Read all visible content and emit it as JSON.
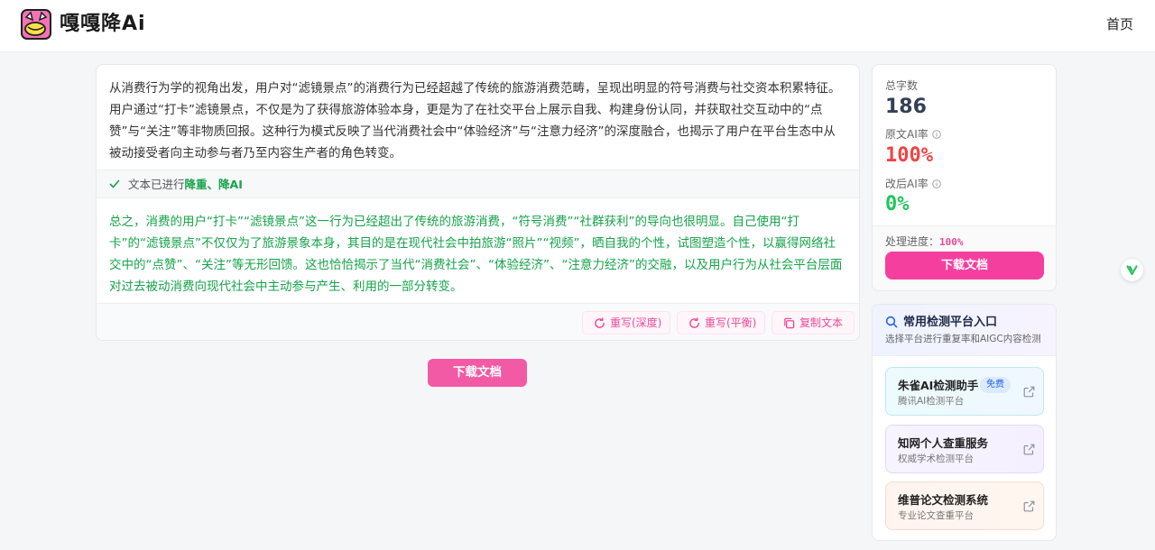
{
  "header": {
    "brand": "嘎嘎降Ai",
    "nav_home": "首页"
  },
  "main": {
    "original_text": "从消费行为学的视角出发，用户对“滤镜景点”的消费行为已经超越了传统的旅游消费范畴，呈现出明显的符号消费与社交资本积累特征。用户通过“打卡”滤镜景点，不仅是为了获得旅游体验本身，更是为了在社交平台上展示自我、构建身份认同，并获取社交互动中的“点赞”与“关注”等非物质回报。这种行为模式反映了当代消费社会中“体验经济”与“注意力经济”的深度融合，也揭示了用户在平台生态中从被动接受者向主动参与者乃至内容生产者的角色转变。",
    "status_prefix": "文本已进行",
    "status_highlight": "降重、降AI",
    "result_text": "总之，消费的用户“打卡”“滤镜景点”这一行为已经超出了传统的旅游消费，“符号消费”“社群获利”的导向也很明显。自己使用“打卡”的“滤镜景点”不仅仅为了旅游景象本身，其目的是在现代社会中拍旅游“照片”“视频”，晒自我的个性，试图塑造个性，以赢得网络社交中的“点赞”、“关注”等无形回馈。这也恰恰揭示了当代“消费社会”、“体验经济”、“注意力经济”的交融，以及用户行为从社会平台层面对过去被动消费向现代社会中主动参与产生、利用的一部分转变。",
    "actions": {
      "rewrite_deep": "重写(深度)",
      "rewrite_balance": "重写(平衡)",
      "copy_text": "复制文本"
    },
    "download_label": "下载文档"
  },
  "stats": {
    "total_label": "总字数",
    "total_value": "186",
    "orig_ai_label": "原文AI率",
    "orig_ai_value": "100%",
    "new_ai_label": "改后AI率",
    "new_ai_value": "0%",
    "progress_label": "处理进度：",
    "progress_value": "100%",
    "download_label": "下载文档",
    "colors": {
      "orig_ai": "#ef4444",
      "new_ai": "#22c55e",
      "accent": "#f53f9e"
    }
  },
  "platforms": {
    "title": "常用检测平台入口",
    "subtitle": "选择平台进行重复率和AIGC内容检测",
    "items": [
      {
        "name": "朱雀AI检测助手",
        "desc": "腾讯AI检测平台",
        "badge": "免费"
      },
      {
        "name": "知网个人查重服务",
        "desc": "权威学术检测平台"
      },
      {
        "name": "维普论文检测系统",
        "desc": "专业论文查重平台"
      }
    ]
  }
}
